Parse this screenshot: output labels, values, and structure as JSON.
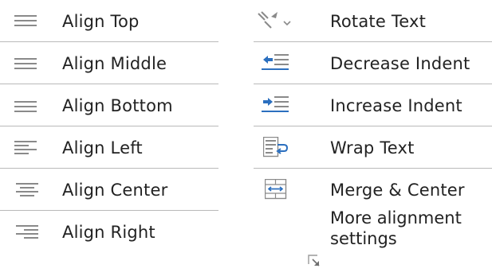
{
  "left_column": {
    "items": [
      {
        "label": "Align Top",
        "icon": "align-top-icon"
      },
      {
        "label": "Align Middle",
        "icon": "align-middle-icon"
      },
      {
        "label": "Align Bottom",
        "icon": "align-bottom-icon"
      },
      {
        "label": "Align Left",
        "icon": "align-left-icon"
      },
      {
        "label": "Align Center",
        "icon": "align-center-icon"
      },
      {
        "label": "Align Right",
        "icon": "align-right-icon"
      }
    ]
  },
  "right_column": {
    "items": [
      {
        "label": "Rotate Text",
        "icon": "rotate-text-icon"
      },
      {
        "label": "Decrease Indent",
        "icon": "decrease-indent-icon"
      },
      {
        "label": "Increase Indent",
        "icon": "increase-indent-icon"
      },
      {
        "label": "Wrap Text",
        "icon": "wrap-text-icon"
      },
      {
        "label": "Merge & Center",
        "icon": "merge-center-icon"
      }
    ],
    "more": {
      "line1": "More alignment",
      "line2": "settings",
      "icon": "dialog-launcher-icon"
    }
  },
  "colors": {
    "icon_gray": "#8a8a8a",
    "icon_blue": "#2b6fbf",
    "divider": "#b9b9b9",
    "text": "#222222"
  }
}
